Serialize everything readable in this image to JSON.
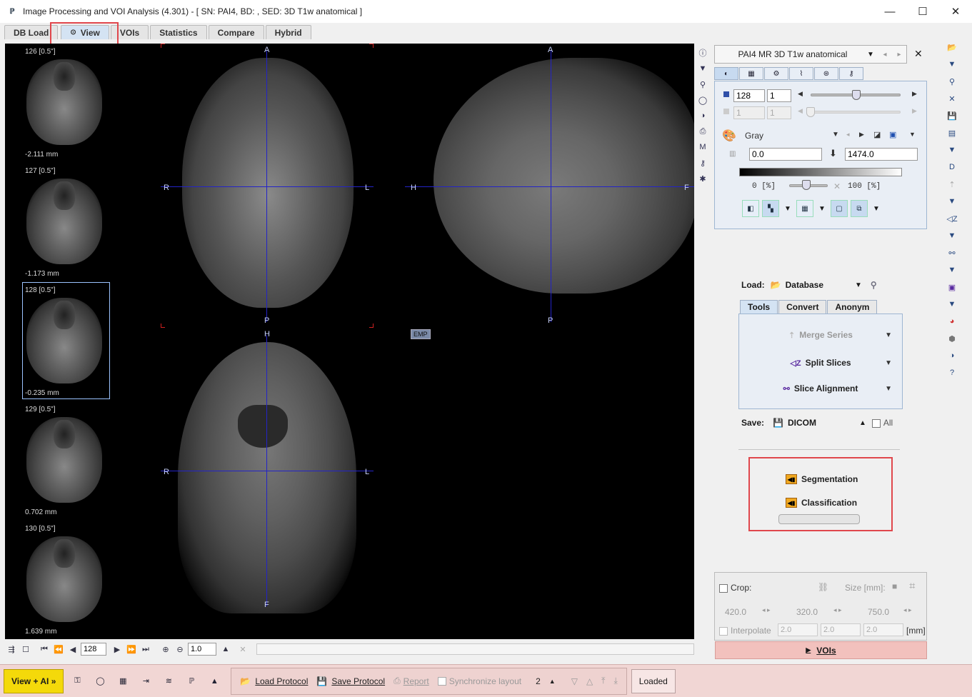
{
  "window": {
    "title": "Image Processing and VOI Analysis (4.301) - [ SN: PAI4, BD: , SED: 3D T1w anatomical ]",
    "app_icon": "PMOD",
    "min": "—",
    "max": "☐",
    "close": "✕"
  },
  "tabs": [
    {
      "label": "DB Load"
    },
    {
      "label": "View"
    },
    {
      "label": "VOIs"
    },
    {
      "label": "Statistics"
    },
    {
      "label": "Compare"
    },
    {
      "label": "Hybrid"
    }
  ],
  "thumbnails": [
    {
      "label": "126 [0.5\"]",
      "pos": "-2.111 mm"
    },
    {
      "label": "127 [0.5\"]",
      "pos": "-1.173 mm"
    },
    {
      "label": "128 [0.5\"]",
      "pos": "-0.235 mm"
    },
    {
      "label": "129 [0.5\"]",
      "pos": "0.702 mm"
    },
    {
      "label": "130 [0.5\"]",
      "pos": "1.639 mm"
    }
  ],
  "orientation": {
    "axial": {
      "top": "A",
      "bottom": "P",
      "left": "R",
      "right": "L"
    },
    "sagittal": {
      "top": "A",
      "bottom": "P",
      "left": "H",
      "right": "F"
    },
    "coronal": {
      "top": "H",
      "bottom": "F",
      "left": "R",
      "right": "L"
    }
  },
  "emp_label": "EMP",
  "nav": {
    "slice_value": "128",
    "zoom_value": "1.0"
  },
  "series": {
    "name": "PAI4 MR 3D T1w anatomical"
  },
  "lut": {
    "slice": "128",
    "step": "1",
    "slice2": "1",
    "step2": "1",
    "colormap": "Gray",
    "min": "0.0",
    "max": "1474.0",
    "lower_pct": "0 [%]",
    "upper_pct": "100 [%]"
  },
  "load": {
    "label": "Load:",
    "source": "Database"
  },
  "panel_tabs": [
    {
      "label": "Tools"
    },
    {
      "label": "Convert"
    },
    {
      "label": "Anonym"
    }
  ],
  "tools": [
    {
      "label": "Merge Series",
      "enabled": false
    },
    {
      "label": "Split Slices",
      "enabled": true
    },
    {
      "label": "Slice Alignment",
      "enabled": true
    }
  ],
  "save": {
    "label": "Save:",
    "format": "DICOM",
    "all_label": "All"
  },
  "ai": {
    "segmentation": "Segmentation",
    "classification": "Classification"
  },
  "crop": {
    "label": "Crop:",
    "size_label": "Size [mm]:",
    "x": "420.0",
    "y": "320.0",
    "z": "750.0",
    "interpolate_label": "Interpolate",
    "i1": "2.0",
    "i2": "2.0",
    "i3": "2.0",
    "unit": "[mm]"
  },
  "vois_button": "VOIs",
  "bottom": {
    "view_ai": "View + AI »",
    "load_protocol": "Load Protocol",
    "save_protocol": "Save Protocol",
    "report": "Report",
    "sync_layout": "Synchronize layout",
    "layout_count": "2",
    "status": "Loaded"
  }
}
